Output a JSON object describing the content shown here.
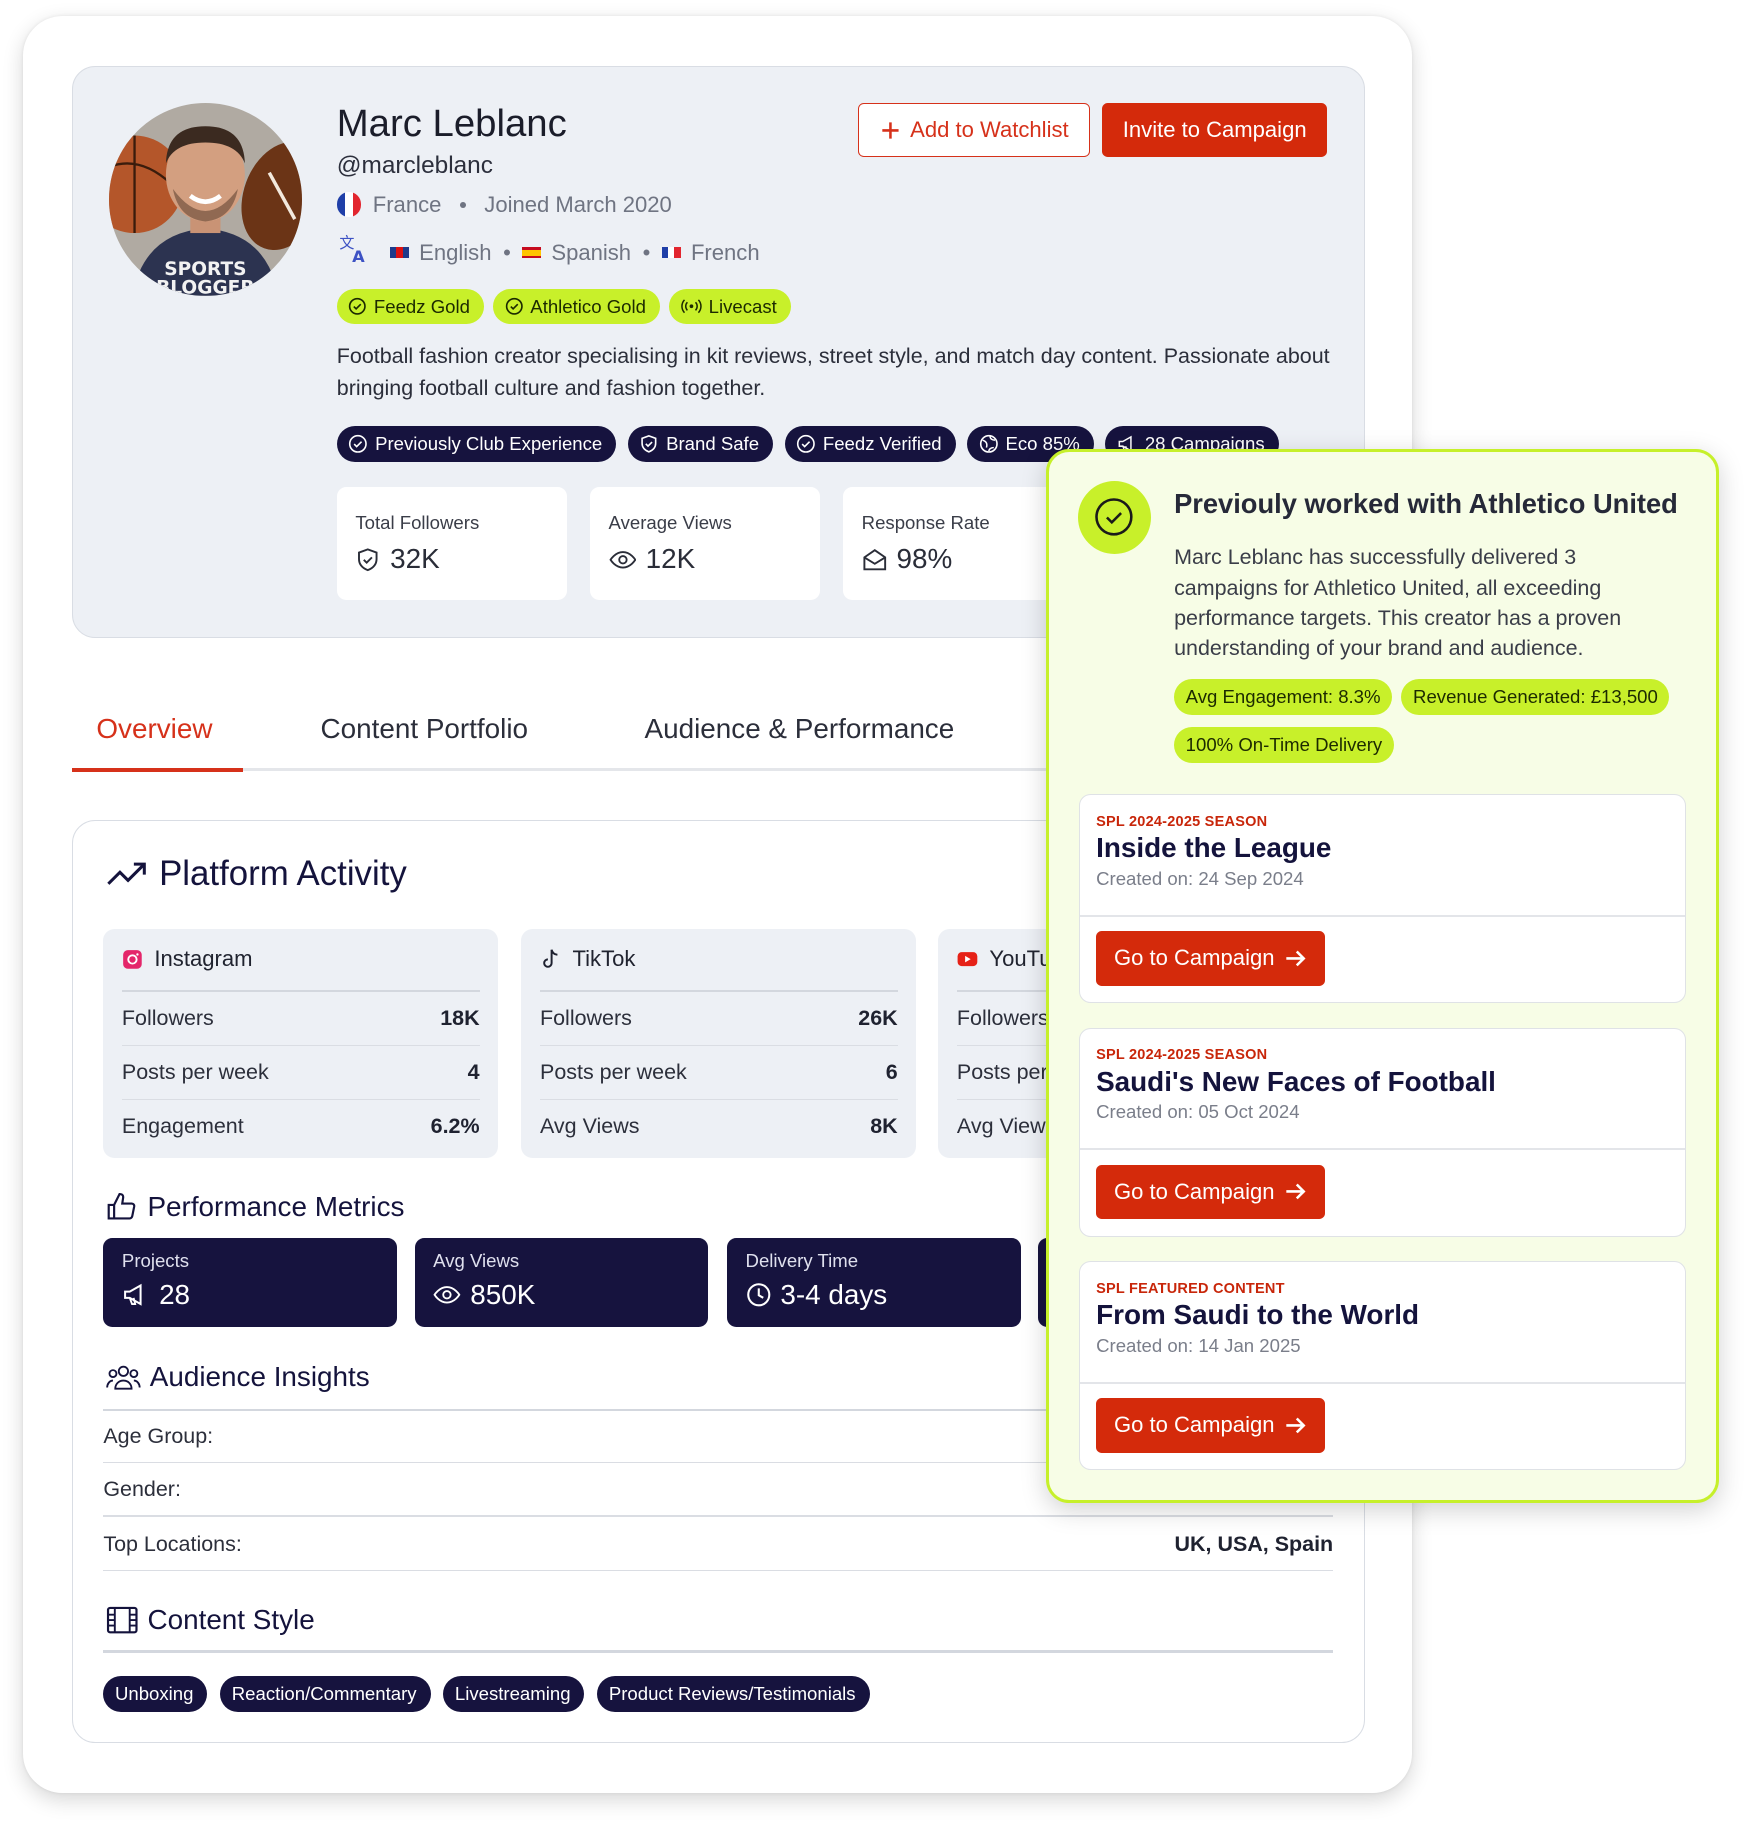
{
  "profile": {
    "name": "Marc Leblanc",
    "handle": "@marcleblanc",
    "country": "France",
    "joined": "Joined March 2020",
    "languages": [
      "English",
      "Spanish",
      "French"
    ],
    "shirt_text_1": "SPORTS",
    "shirt_text_2": "BLOGGER",
    "badges": [
      "Feedz Gold",
      "Athletico Gold",
      "Livecast"
    ],
    "bio": "Football fashion creator specialising in kit reviews, street style, and match day content. Passionate about bringing football culture and fashion together.",
    "tags": [
      "Previously Club Experience",
      "Brand Safe",
      "Feedz Verified",
      "Eco 85%",
      "28 Campaigns"
    ],
    "actions": {
      "watchlist": "Add to Watchlist",
      "invite": "Invite to Campaign"
    },
    "stats": [
      {
        "label": "Total Followers",
        "value": "32K",
        "icon": "shield-check-icon"
      },
      {
        "label": "Average Views",
        "value": "12K",
        "icon": "eye-icon"
      },
      {
        "label": "Response Rate",
        "value": "98%",
        "icon": "envelope-open-icon"
      }
    ]
  },
  "tabs": [
    "Overview",
    "Content Portfolio",
    "Audience & Performance"
  ],
  "active_tab": "Overview",
  "platform_activity": {
    "title": "Platform Activity",
    "platforms": [
      {
        "name": "Instagram",
        "icon": "instagram-icon",
        "rows": [
          [
            "Followers",
            "18K"
          ],
          [
            "Posts per week",
            "4"
          ],
          [
            "Engagement",
            "6.2%"
          ]
        ]
      },
      {
        "name": "TikTok",
        "icon": "tiktok-icon",
        "rows": [
          [
            "Followers",
            "26K"
          ],
          [
            "Posts per week",
            "6"
          ],
          [
            "Avg Views",
            "8K"
          ]
        ]
      },
      {
        "name": "YouTu",
        "icon": "youtube-icon",
        "rows": [
          [
            "Followers",
            ""
          ],
          [
            "Posts per",
            ""
          ],
          [
            "Avg View",
            ""
          ]
        ]
      }
    ]
  },
  "performance": {
    "title": "Performance Metrics",
    "metrics": [
      {
        "label": "Projects",
        "value": "28",
        "icon": "megaphone-icon"
      },
      {
        "label": "Avg Views",
        "value": "850K",
        "icon": "eye-icon"
      },
      {
        "label": "Delivery Time",
        "value": "3-4 days",
        "icon": "clock-icon"
      }
    ]
  },
  "audience": {
    "title": "Audience Insights",
    "rows": [
      {
        "label": "Age Group:",
        "value": ""
      },
      {
        "label": "Gender:",
        "value": ""
      },
      {
        "label": "Top Locations:",
        "value": "UK, USA, Spain"
      }
    ]
  },
  "content_style": {
    "title": "Content Style",
    "tags": [
      "Unboxing",
      "Reaction/Commentary",
      "Livestreaming",
      "Product Reviews/Testimonials"
    ]
  },
  "overlay": {
    "title": "Previouly worked with Athletico United",
    "description": "Marc Leblanc has successfully delivered 3 campaigns for Athletico United, all exceeding performance targets. This creator has a proven understanding of your brand and audience.",
    "chips": [
      "Avg Engagement: 8.3%",
      "Revenue Generated: £13,500",
      "100% On-Time Delivery"
    ],
    "campaigns": [
      {
        "tag": "SPL 2024-2025 SEASON",
        "name": "Inside the League",
        "created": "Created on: 24 Sep 2024",
        "button": "Go to Campaign"
      },
      {
        "tag": "SPL 2024-2025 SEASON",
        "name": "Saudi's New Faces of Football",
        "created": "Created on: 05 Oct 2024",
        "button": "Go to Campaign"
      },
      {
        "tag": "SPL FEATURED CONTENT",
        "name": "From Saudi to the World",
        "created": "Created on: 14 Jan 2025",
        "button": "Go to Campaign"
      }
    ]
  },
  "colors": {
    "accent_red": "#d42a0b",
    "navy": "#16133e",
    "lime": "#c8f02a"
  }
}
